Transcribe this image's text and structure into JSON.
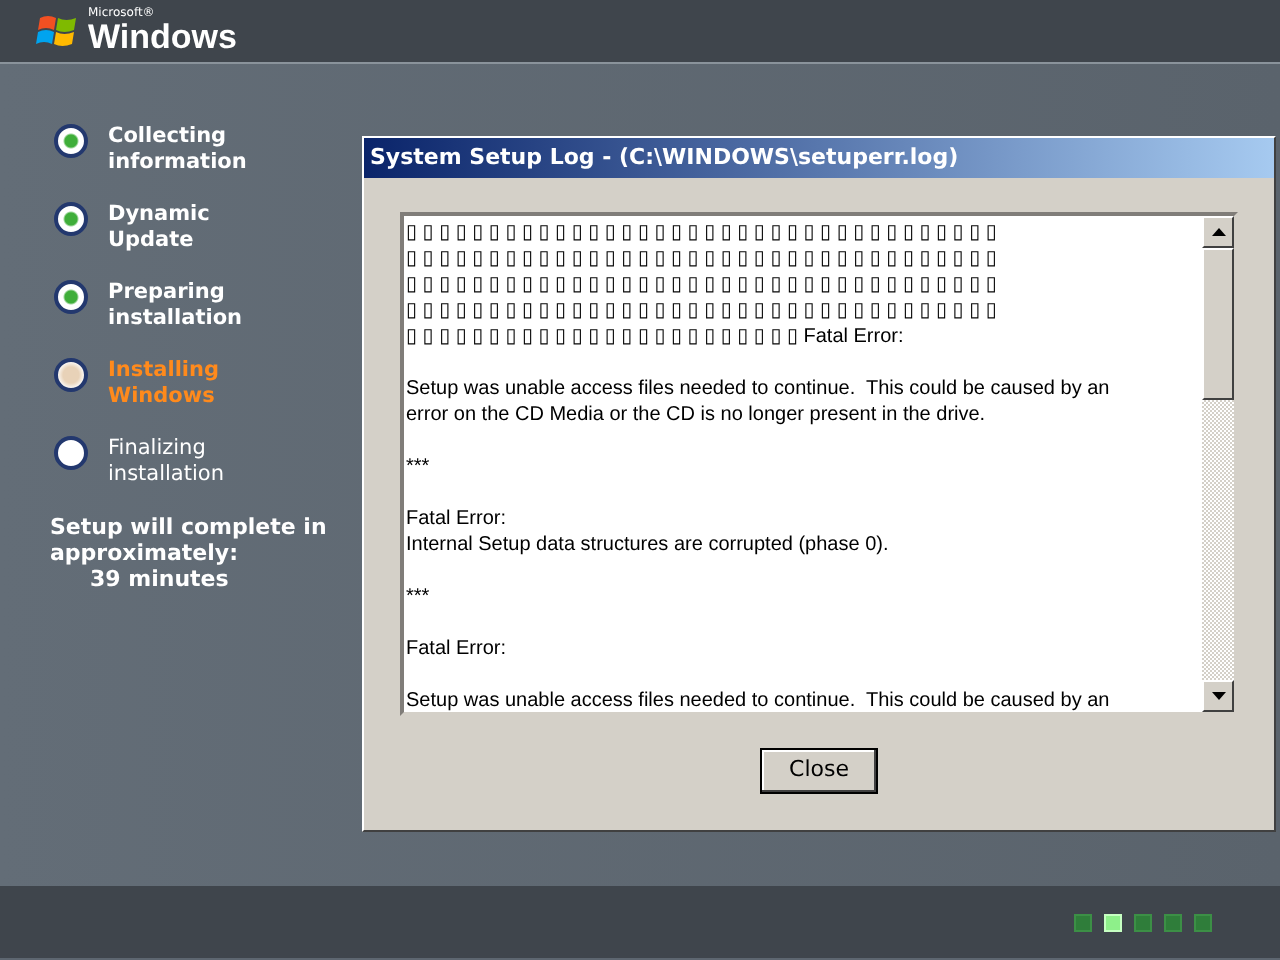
{
  "logo": {
    "brand_small": "Microsoft®",
    "brand": "Windows"
  },
  "steps": [
    {
      "label": "Collecting\ninformation",
      "kind": "done"
    },
    {
      "label": "Dynamic\nUpdate",
      "kind": "done"
    },
    {
      "label": "Preparing\ninstallation",
      "kind": "done"
    },
    {
      "label": "Installing\nWindows",
      "kind": "current"
    },
    {
      "label": "Finalizing\ninstallation",
      "kind": "pending"
    }
  ],
  "estimate": {
    "label": "Setup will complete in\napproximately:",
    "time": "39 minutes"
  },
  "dialog": {
    "title": "System Setup Log - (C:\\WINDOWS\\setuperr.log)",
    "log": [
      [
        "▯ ▯ ▯ ▯ ▯ ▯ ▯ ▯ ▯ ▯ ▯ ▯ ▯ ▯ ▯ ▯ ▯ ▯ ▯ ▯ ▯ ▯ ▯ ▯ ▯ ▯ ▯ ▯ ▯ ▯ ▯ ▯ ▯ ▯ ▯ ▯",
        "▯ ▯ ▯ ▯ ▯ ▯ ▯ ▯ ▯ ▯ ▯ ▯ ▯ ▯ ▯ ▯ ▯ ▯ ▯ ▯ ▯ ▯ ▯ ▯ ▯ ▯ ▯ ▯ ▯ ▯ ▯ ▯ ▯ ▯ ▯ ▯",
        "▯ ▯ ▯ ▯ ▯ ▯ ▯ ▯ ▯ ▯ ▯ ▯ ▯ ▯ ▯ ▯ ▯ ▯ ▯ ▯ ▯ ▯ ▯ ▯ ▯ ▯ ▯ ▯ ▯ ▯ ▯ ▯ ▯ ▯ ▯ ▯",
        "▯ ▯ ▯ ▯ ▯ ▯ ▯ ▯ ▯ ▯ ▯ ▯ ▯ ▯ ▯ ▯ ▯ ▯ ▯ ▯ ▯ ▯ ▯ ▯ ▯ ▯ ▯ ▯ ▯ ▯ ▯ ▯ ▯ ▯ ▯ ▯",
        "▯ ▯ ▯ ▯ ▯ ▯ ▯ ▯ ▯ ▯ ▯ ▯ ▯ ▯ ▯ ▯ ▯ ▯ ▯ ▯ ▯ ▯ ▯ ▯ Fatal Error:"
      ],
      [
        "Setup was unable access files needed to continue.  This could be caused by an",
        "error on the CD Media or the CD is no longer present in the drive."
      ],
      [
        "***"
      ],
      [
        "Fatal Error:",
        "Internal Setup data structures are corrupted (phase 0)."
      ],
      [
        "***"
      ],
      [
        "Fatal Error:"
      ],
      [
        "Setup was unable access files needed to continue.  This could be caused by an"
      ]
    ],
    "close_button": "Close"
  },
  "progress_squares": [
    {
      "selected": false
    },
    {
      "selected": true
    },
    {
      "selected": false
    },
    {
      "selected": false
    },
    {
      "selected": false
    }
  ]
}
